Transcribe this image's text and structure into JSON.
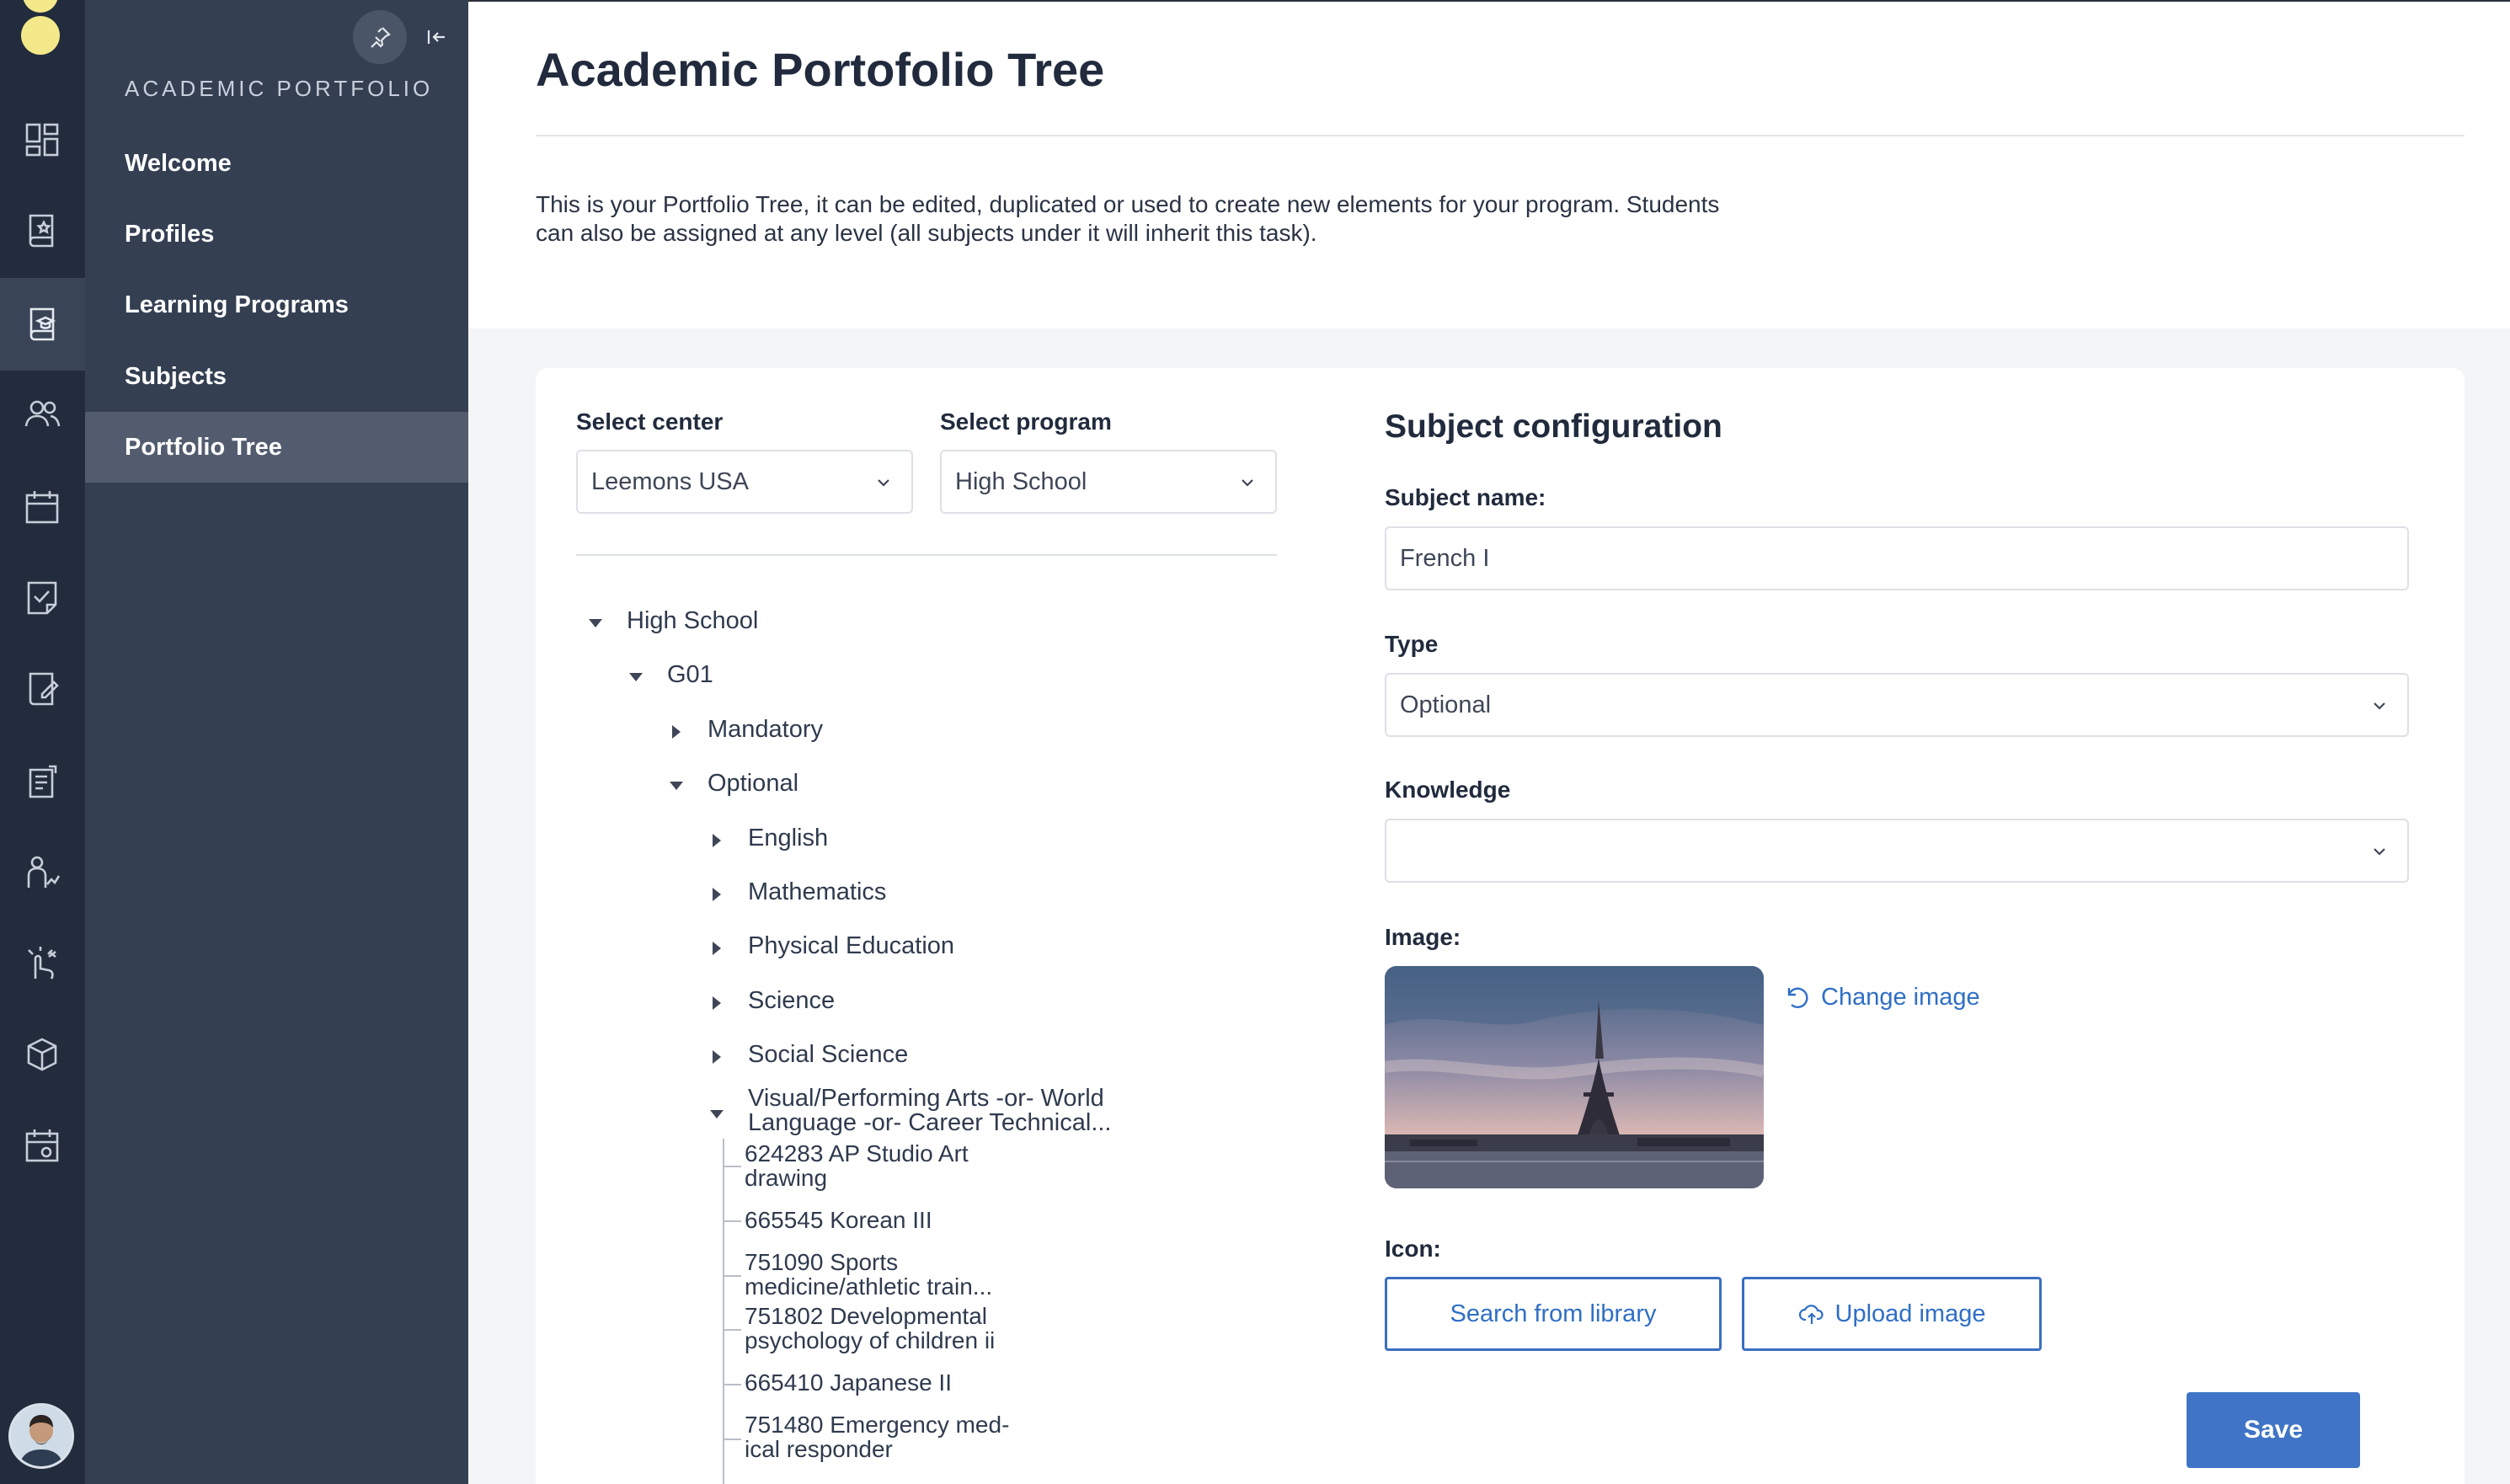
{
  "sidebar": {
    "section_title": "ACADEMIC PORTFOLIO",
    "items": [
      {
        "label": "Welcome"
      },
      {
        "label": "Profiles"
      },
      {
        "label": "Learning Programs"
      },
      {
        "label": "Subjects"
      },
      {
        "label": "Portfolio Tree"
      }
    ],
    "active_index": 4
  },
  "rail_icons": [
    "dashboard-icon",
    "book-star-icon",
    "book-graduation-icon",
    "users-icon",
    "calendar-icon",
    "task-check-icon",
    "edit-note-icon",
    "document-list-icon",
    "people-growth-icon",
    "pointer-click-icon",
    "box-icon",
    "calendar-settings-icon"
  ],
  "page": {
    "title": "Academic Portofolio Tree",
    "description_line1": "This is your Portfolio Tree, it can be edited, duplicated or used to create new elements for your program. Students",
    "description_line2": "can also be assigned at any level (all subjects under it will inherit this task)."
  },
  "filters": {
    "center_label": "Select center",
    "center_value": "Leemons USA",
    "program_label": "Select program",
    "program_value": "High School"
  },
  "tree": {
    "root": "High School",
    "level1": "G01",
    "mandatory": "Mandatory",
    "optional": "Optional",
    "optional_children": [
      "English",
      "Mathematics",
      "Physical Education",
      "Science",
      "Social Science"
    ],
    "visual_line1": "Visual/Performing Arts -or- World",
    "visual_line2": "Language -or- Career Technical...",
    "leaves": [
      {
        "l1": "624283 AP Studio Art",
        "l2": "drawing"
      },
      {
        "l1": "665545 Korean III",
        "l2": ""
      },
      {
        "l1": "751090 Sports",
        "l2": "medicine/athletic train..."
      },
      {
        "l1": "751802 Developmental",
        "l2": "psychology of children ii"
      },
      {
        "l1": "665410 Japanese II",
        "l2": ""
      },
      {
        "l1": "751480 Emergency med-",
        "l2": "ical responder"
      }
    ]
  },
  "config": {
    "title": "Subject configuration",
    "name_label": "Subject name:",
    "name_value": "French I",
    "type_label": "Type",
    "type_value": "Optional",
    "knowledge_label": "Knowledge",
    "knowledge_value": "",
    "image_label": "Image:",
    "change_image": "Change image",
    "icon_label": "Icon:",
    "search_library": "Search from library",
    "upload_image": "Upload image",
    "save": "Save"
  },
  "colors": {
    "rail": "#232c3d",
    "subnav": "#343f52",
    "accent": "#3f74c6",
    "logo": "#f4e98a"
  }
}
